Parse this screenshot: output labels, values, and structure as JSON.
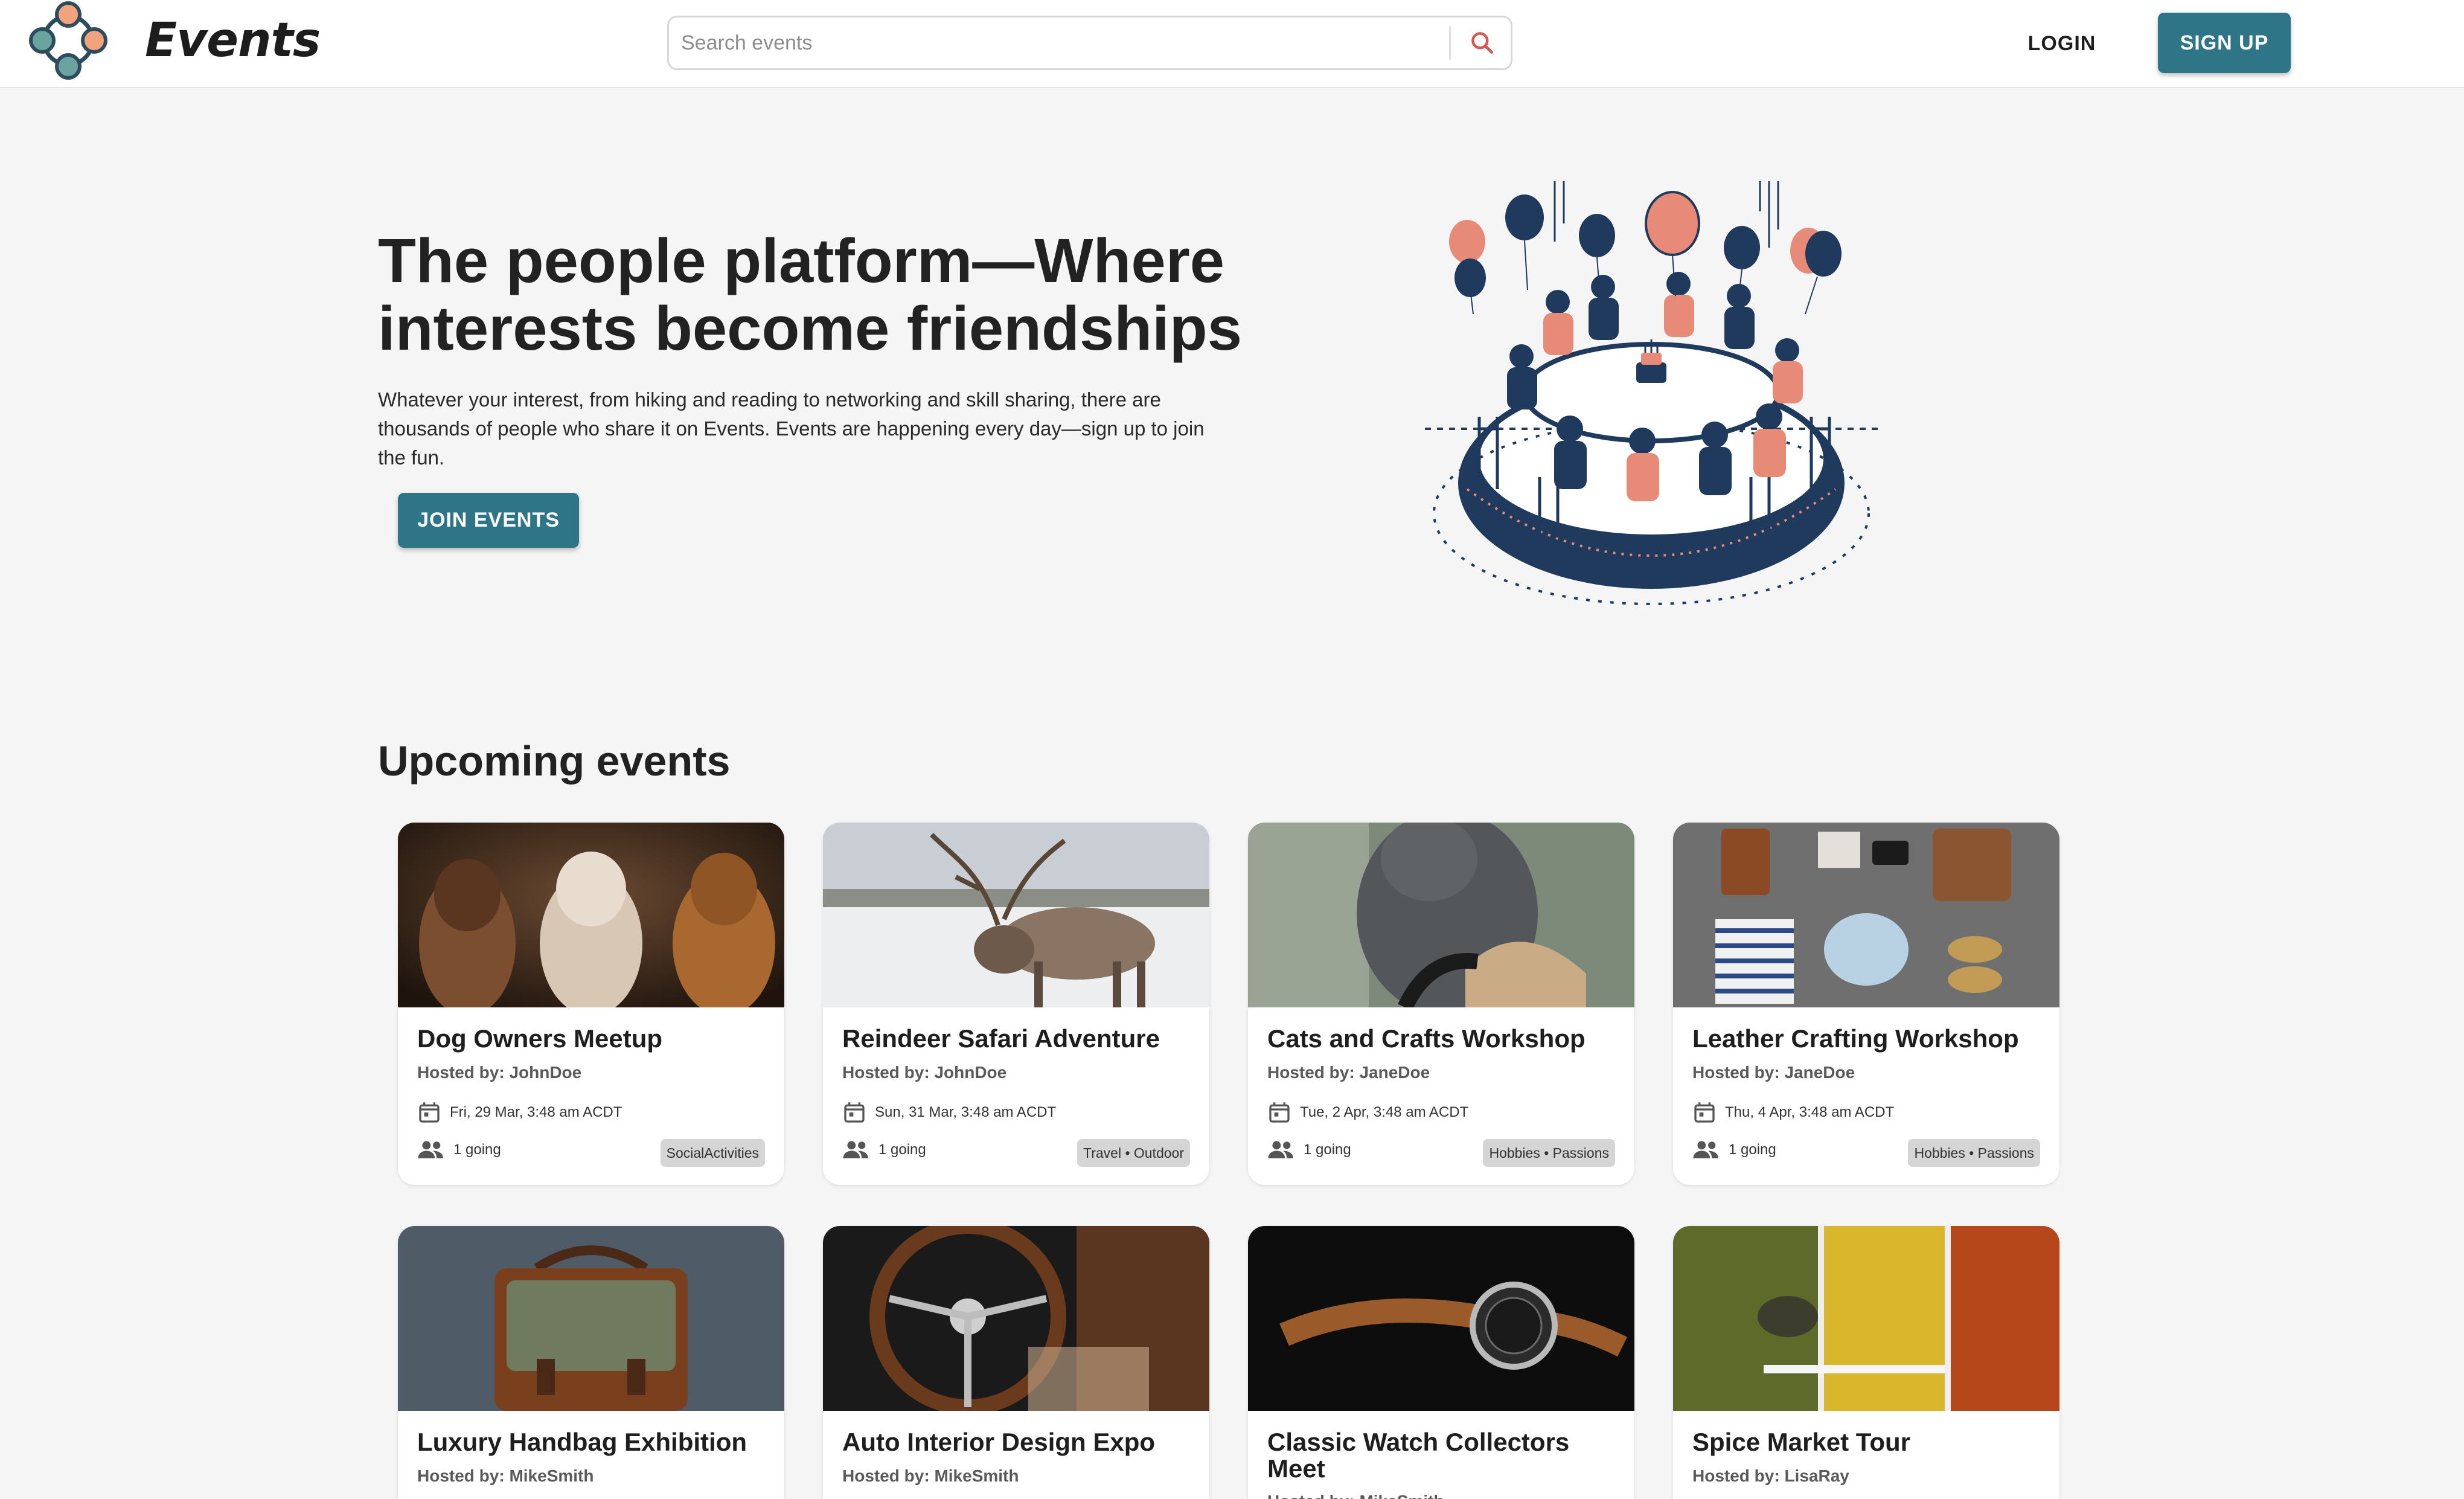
{
  "header": {
    "brand": "Events",
    "search": {
      "placeholder": "Search events"
    },
    "login_label": "LOGIN",
    "signup_label": "SIGN UP"
  },
  "hero": {
    "title": "The people platform—Where interests become friendships",
    "text": "Whatever your interest, from hiking and reading to networking and skill sharing, there are thousands of people who share it on Events. Events are happening every day—sign up to join the fun.",
    "join_label": "JOIN EVENTS"
  },
  "upcoming": {
    "title": "Upcoming events",
    "events": [
      {
        "title": "Dog Owners Meetup",
        "host": "Hosted by: JohnDoe",
        "date": "Fri, 29 Mar, 3:48 am ACDT",
        "going": "1 going",
        "tag": "SocialActivities"
      },
      {
        "title": "Reindeer Safari Adventure",
        "host": "Hosted by: JohnDoe",
        "date": "Sun, 31 Mar, 3:48 am ACDT",
        "going": "1 going",
        "tag": "Travel • Outdoor"
      },
      {
        "title": "Cats and Crafts Workshop",
        "host": "Hosted by: JaneDoe",
        "date": "Tue, 2 Apr, 3:48 am ACDT",
        "going": "1 going",
        "tag": "Hobbies • Passions"
      },
      {
        "title": "Leather Crafting Workshop",
        "host": "Hosted by: JaneDoe",
        "date": "Thu, 4 Apr, 3:48 am ACDT",
        "going": "1 going",
        "tag": "Hobbies • Passions"
      },
      {
        "title": "Luxury Handbag Exhibition",
        "host": "Hosted by: MikeSmith"
      },
      {
        "title": "Auto Interior Design Expo",
        "host": "Hosted by: MikeSmith"
      },
      {
        "title": "Classic Watch Collectors Meet",
        "host": "Hosted by: MikeSmith"
      },
      {
        "title": "Spice Market Tour",
        "host": "Hosted by: LisaRay"
      }
    ]
  },
  "colors": {
    "accent": "#2f7588",
    "salmon": "#e88a78",
    "navy": "#1f3a5c"
  }
}
